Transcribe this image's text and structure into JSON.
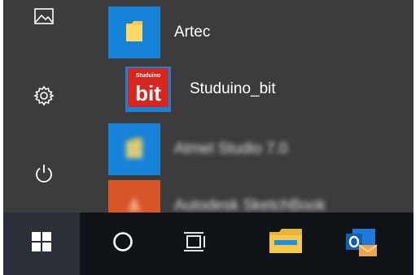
{
  "start_menu": {
    "left_rail": {
      "pictures_icon": "pictures-icon",
      "settings_icon": "gear-icon",
      "power_icon": "power-icon"
    },
    "apps": [
      {
        "label": "Artec",
        "icon": "folder-icon",
        "tile_color": "#1683d8"
      },
      {
        "label": "Studuino_bit",
        "icon": "studuino-bit-icon",
        "tile_color": "#1683d8",
        "logo_small": "Studuino",
        "logo_big": "bit"
      },
      {
        "label": "Atmel Studio 7.0",
        "icon": "folder-icon",
        "tile_color": "#1683d8"
      },
      {
        "label": "Autodesk SketchBook",
        "icon": "sketchbook-icon",
        "tile_color": "#d6562a"
      }
    ]
  },
  "taskbar": {
    "items": [
      {
        "name": "start-button",
        "icon": "windows-logo-icon"
      },
      {
        "name": "cortana-button",
        "icon": "circle-icon"
      },
      {
        "name": "task-view-button",
        "icon": "task-view-icon"
      },
      {
        "name": "file-explorer-button",
        "icon": "folder-icon"
      },
      {
        "name": "outlook-button",
        "icon": "outlook-icon"
      }
    ]
  },
  "colors": {
    "menu_bg": "#3c3c3c",
    "taskbar_bg": "#101318",
    "accent": "#1683d8",
    "studuino_red": "#d7261e"
  }
}
